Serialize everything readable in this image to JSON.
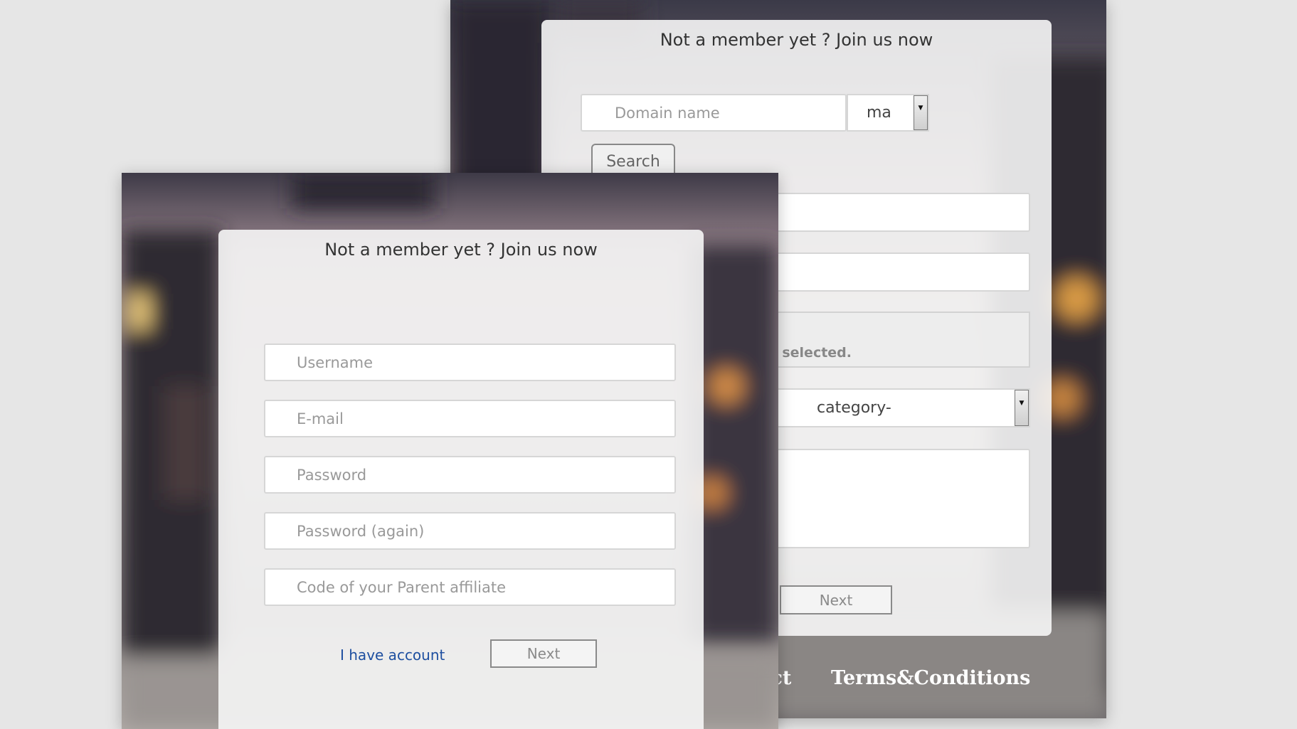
{
  "back_form": {
    "title": "Not a member yet ? Join us now",
    "domain_placeholder": "Domain name",
    "tld_value": "ma",
    "search_label": "Search",
    "file_status": "selected.",
    "category_value": "category-",
    "next_label": "Next",
    "footer_partial_link": "act",
    "footer_terms": "Terms&Conditions"
  },
  "front_form": {
    "title": "Not a member yet ? Join us now",
    "username_placeholder": "Username",
    "email_placeholder": "E-mail",
    "password_placeholder": "Password",
    "password_again_placeholder": "Password (again)",
    "affiliate_placeholder": "Code of your Parent affiliate",
    "account_link": "I have account",
    "next_label": "Next"
  },
  "colors": {
    "page_bg": "#e6e6e6",
    "link": "#1e4fa0",
    "panel": "#f6f6f6"
  },
  "icons": {
    "select_arrow": "triangle-down"
  }
}
